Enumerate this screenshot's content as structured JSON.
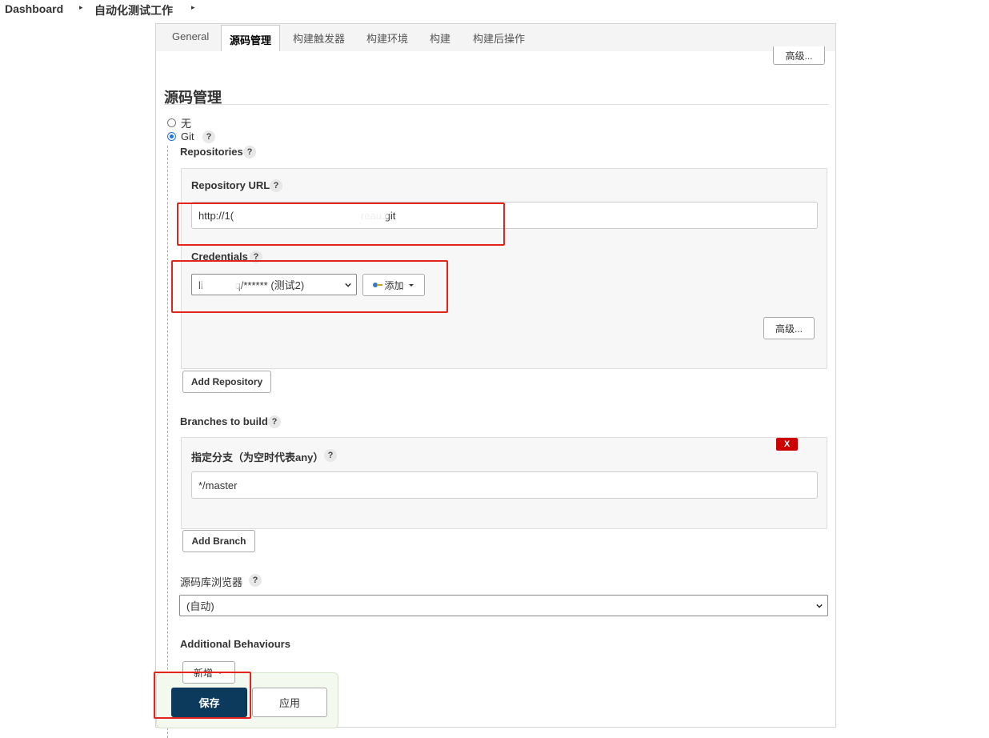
{
  "breadcrumb": {
    "items": [
      "Dashboard",
      "自动化测试工作"
    ]
  },
  "tabs": [
    "General",
    "源码管理",
    "构建触发器",
    "构建环境",
    "构建",
    "构建后操作"
  ],
  "active_tab": "源码管理",
  "top_advanced_label": "高级...",
  "section_title": "源码管理",
  "scm_options": [
    {
      "label": "无",
      "selected": false
    },
    {
      "label": "Git",
      "selected": true
    }
  ],
  "help_glyph": "?",
  "repositories": {
    "label": "Repositories",
    "repository_url_label": "Repository URL",
    "repository_url_value": "http://1(                                            reau.git",
    "credentials_label": "Credentials",
    "credentials_value": "li           q/****** (测试2)",
    "add_credential_label": "添加",
    "advanced_label": "高级...",
    "add_repository_label": "Add Repository"
  },
  "branches": {
    "label": "Branches to build",
    "branch_spec_label": "指定分支（为空时代表any）",
    "branch_spec_value": "*/master",
    "delete_label": "X",
    "add_branch_label": "Add Branch"
  },
  "repo_browser": {
    "label": "源码库浏览器",
    "value": "(自动)"
  },
  "additional_behaviours": {
    "label": "Additional Behaviours",
    "add_label": "新增"
  },
  "actions": {
    "save_label": "保存",
    "apply_label": "应用"
  },
  "colors": {
    "save_button": "#0b3a5c",
    "annotation_red": "#e3241c",
    "delete_red": "#cc0000"
  }
}
